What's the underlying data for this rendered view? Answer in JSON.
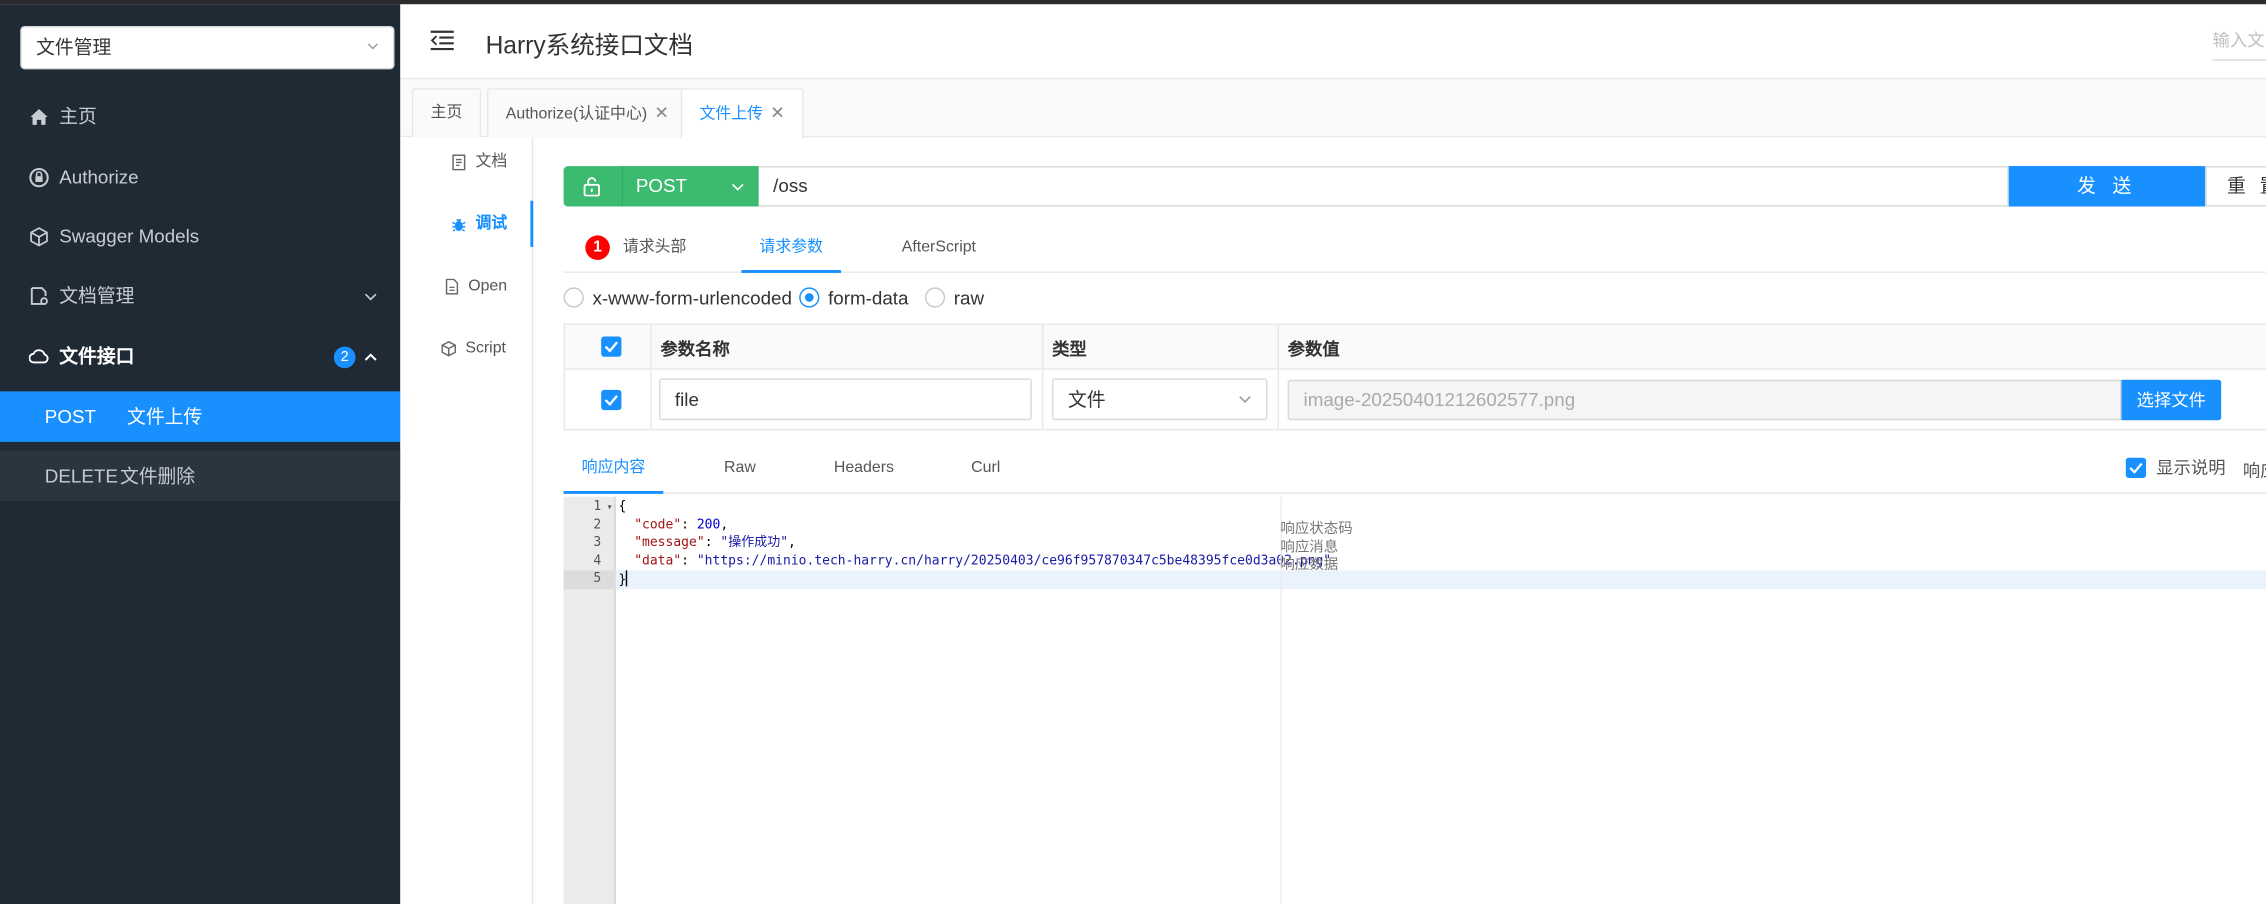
{
  "sidebar": {
    "group_select": "文件管理",
    "items": [
      {
        "label": "主页",
        "icon": "home-icon"
      },
      {
        "label": "Authorize",
        "icon": "lock-icon"
      },
      {
        "label": "Swagger Models",
        "icon": "cube-icon"
      },
      {
        "label": "文档管理",
        "icon": "document-settings-icon"
      },
      {
        "label": "文件接口",
        "icon": "cloud-icon",
        "badge": "2"
      }
    ],
    "sub_items": [
      {
        "method": "POST",
        "name": "文件上传"
      },
      {
        "method": "DELETE",
        "name": "文件删除"
      }
    ]
  },
  "header": {
    "title": "Harry系统接口文档",
    "search_placeholder": "输入文"
  },
  "page_tabs": [
    {
      "label": "主页"
    },
    {
      "label": "Authorize(认证中心)"
    },
    {
      "label": "文件上传"
    }
  ],
  "side_tabs": [
    {
      "label": "文档"
    },
    {
      "label": "调试"
    },
    {
      "label": "Open"
    },
    {
      "label": "Script"
    }
  ],
  "request": {
    "method": "POST",
    "url": "/oss",
    "send_label": "发 送",
    "reset_label": "重 置",
    "tabs": [
      {
        "label": "请求头部",
        "badge": "1"
      },
      {
        "label": "请求参数"
      },
      {
        "label": "AfterScript"
      }
    ],
    "body_types": [
      "x-www-form-urlencoded",
      "form-data",
      "raw"
    ],
    "selected_body_type": "form-data",
    "params_headers": {
      "name": "参数名称",
      "type": "类型",
      "value": "参数值"
    },
    "params": [
      {
        "name": "file",
        "type": "文件",
        "value": "image-20250401212602577.png"
      }
    ],
    "choose_file_label": "选择文件"
  },
  "response": {
    "tabs": [
      "响应内容",
      "Raw",
      "Headers",
      "Curl"
    ],
    "show_desc_label": "显示说明",
    "cut_label": "响应",
    "line_numbers": [
      "1",
      "2",
      "3",
      "4",
      "5"
    ],
    "json": {
      "code": "200",
      "message": "\"操作成功\"",
      "data": "\"https://minio.tech-harry.cn/harry/20250403/ce96f957870347c5be48395fce0d3a02.png\""
    },
    "descriptions": [
      "响应状态码",
      "响应消息",
      "响应数据"
    ]
  },
  "colors": {
    "sidebar_bg": "#1f2a35",
    "accent": "#1890ff",
    "method_post": "#3cba6f",
    "error_badge": "#ff0000"
  }
}
